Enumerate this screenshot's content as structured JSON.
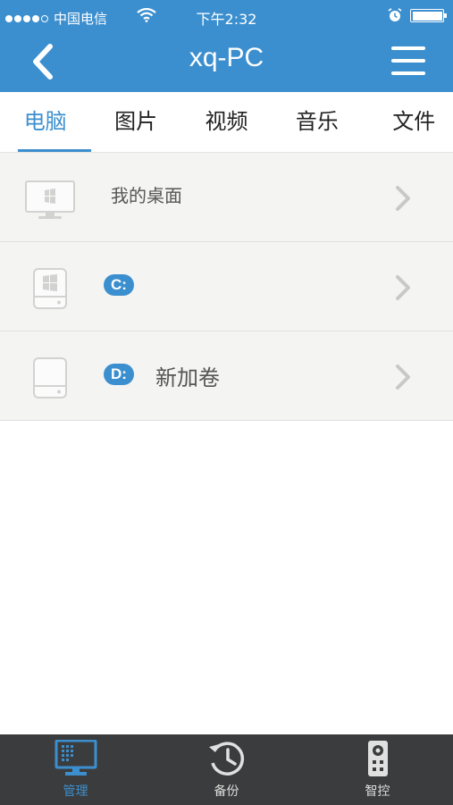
{
  "status_bar": {
    "carrier": "中国电信",
    "time": "下午2:32"
  },
  "nav": {
    "title": "xq-PC"
  },
  "tabs": [
    {
      "label": "电脑",
      "active": true
    },
    {
      "label": "图片",
      "active": false
    },
    {
      "label": "视频",
      "active": false
    },
    {
      "label": "音乐",
      "active": false
    },
    {
      "label": "文件",
      "active": false
    }
  ],
  "list": {
    "items": [
      {
        "icon": "desktop-monitor-icon",
        "label": "我的桌面"
      },
      {
        "icon": "system-drive-icon",
        "badge": "C:",
        "label": ""
      },
      {
        "icon": "hard-drive-icon",
        "badge": "D:",
        "label": "新加卷"
      }
    ]
  },
  "tabbar": {
    "items": [
      {
        "icon": "monitor-grid-icon",
        "label": "管理",
        "active": true
      },
      {
        "icon": "backup-clock-icon",
        "label": "备份",
        "active": false
      },
      {
        "icon": "remote-control-icon",
        "label": "智控",
        "active": false
      }
    ]
  },
  "colors": {
    "accent": "#3c8fcf",
    "list_bg": "#f4f5f3",
    "tabbar_bg": "#3b3c3d"
  }
}
